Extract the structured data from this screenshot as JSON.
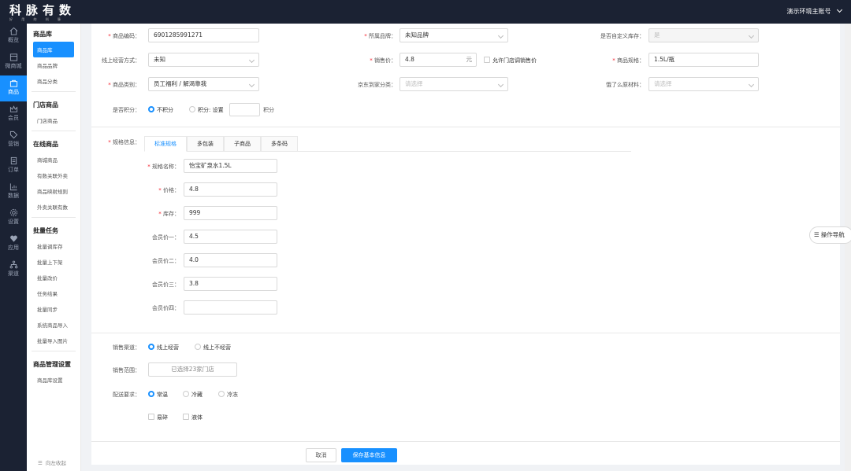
{
  "brand": {
    "title": "科脉有数",
    "subtitle": "好 用 的 科 脉"
  },
  "account": {
    "label": "演示环境主账号"
  },
  "icon_nav": [
    {
      "label": "概览",
      "icon": "home-icon"
    },
    {
      "label": "微商城",
      "icon": "store-icon"
    },
    {
      "label": "商品",
      "icon": "bag-icon"
    },
    {
      "label": "会员",
      "icon": "crown-icon"
    },
    {
      "label": "营销",
      "icon": "tag-icon"
    },
    {
      "label": "订单",
      "icon": "doc-icon"
    },
    {
      "label": "数据",
      "icon": "chart-icon"
    },
    {
      "label": "设置",
      "icon": "gear-icon"
    },
    {
      "label": "应用",
      "icon": "heart-icon"
    },
    {
      "label": "渠道",
      "icon": "tree-icon"
    }
  ],
  "sub_nav": {
    "groups": [
      {
        "title": "商品库",
        "items": [
          "商品库",
          "商品品牌",
          "商品分类"
        ]
      },
      {
        "title": "门店商品",
        "items": [
          "门店商品"
        ]
      },
      {
        "title": "在线商品",
        "items": [
          "商城商品",
          "有数关联外卖",
          "商品映射规则",
          "外卖关联有数"
        ]
      },
      {
        "title": "批量任务",
        "items": [
          "批量调库存",
          "批量上下架",
          "批量改价",
          "任务结果",
          "批量同步",
          "系统商品导入",
          "批量导入图片"
        ]
      },
      {
        "title": "商品管理设置",
        "items": [
          "商品库设置"
        ]
      }
    ],
    "collapse_label": "向左收起"
  },
  "form": {
    "barcode_label": "商品编码：",
    "barcode_value": "6901285991271",
    "brand_label": "所属品牌：",
    "brand_value": "未知品牌",
    "custom_stock_label": "是否自定义库存：",
    "custom_stock_value": "是",
    "online_mode_label": "线上经营方式：",
    "online_mode_value": "未知",
    "price_label": "销售价：",
    "price_value": "4.8",
    "price_suffix": "元",
    "allow_store_price_label": "允许门店调销售价",
    "spec_label": "商品规格：",
    "spec_value": "1.5L/瓶",
    "category_label": "商品类别：",
    "category_value": "员工福利 / 解渴靠我",
    "jd_category_label": "京东到家分类：",
    "jd_category_placeholder": "请选择",
    "eleme_label": "饿了么原材料：",
    "eleme_placeholder": "请选择",
    "points_label": "是否积分：",
    "points_opt1": "不积分",
    "points_opt2": "积分: 设置",
    "points_suffix": "积分"
  },
  "spec": {
    "label": "规格信息：",
    "tabs": [
      "标准规格",
      "多包装",
      "子商品",
      "多条码"
    ],
    "fields": [
      {
        "label": "规格名称：",
        "value": "怡宝矿泉水1.5L",
        "required": true
      },
      {
        "label": "价格：",
        "value": "4.8",
        "required": true
      },
      {
        "label": "库存：",
        "value": "999",
        "required": true
      },
      {
        "label": "会员价一：",
        "value": "4.5",
        "required": false
      },
      {
        "label": "会员价二：",
        "value": "4.0",
        "required": false
      },
      {
        "label": "会员价三：",
        "value": "3.8",
        "required": false
      },
      {
        "label": "会员价四：",
        "value": "",
        "required": false
      }
    ]
  },
  "sales": {
    "channel_label": "销售渠道：",
    "channel_opt1": "线上经营",
    "channel_opt2": "线上不经营",
    "scope_label": "销售范围：",
    "scope_value": "已选择23家门店",
    "delivery_label": "配送要求：",
    "delivery_opt1": "常温",
    "delivery_opt2": "冷藏",
    "delivery_opt3": "冷冻",
    "fragile_label": "易碎",
    "liquid_label": "液体"
  },
  "buttons": {
    "cancel": "取消",
    "save": "保存基本信息"
  },
  "guide": {
    "label": "操作导航"
  },
  "colors": {
    "accent": "#1890ff",
    "nav_bg": "#1b2233",
    "required": "#f5222d"
  }
}
